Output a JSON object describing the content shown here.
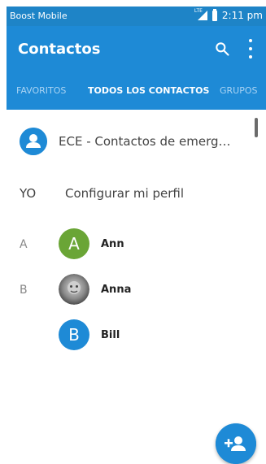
{
  "status_bar": {
    "carrier": "Boost Mobile",
    "network": "LTE",
    "time": "2:11 pm"
  },
  "app_bar": {
    "title": "Contactos",
    "tabs": [
      {
        "label": "FAVORITOS",
        "active": false
      },
      {
        "label": "TODOS LOS CONTACTOS",
        "active": true
      },
      {
        "label": "GRUPOS",
        "active": false
      }
    ]
  },
  "emergency": {
    "label": "ECE - Contactos de emerg…"
  },
  "profile": {
    "section": "YO",
    "label": "Configurar mi perfil"
  },
  "sections": [
    {
      "letter": "A",
      "contacts": [
        {
          "initial": "A",
          "name": "Ann",
          "color": "#6aa536"
        }
      ]
    },
    {
      "letter": "B",
      "contacts": [
        {
          "initial": "",
          "name": "Anna",
          "color": "#7a7a7a"
        },
        {
          "initial": "B",
          "name": "Bill",
          "color": "#1e8ad6"
        }
      ]
    }
  ],
  "colors": {
    "primary": "#1e8ad6",
    "status": "#1e84c7"
  },
  "icons": {
    "search": "search-icon",
    "more": "more-vert-icon",
    "ece": "person-icon",
    "fab": "add-contact-icon"
  }
}
